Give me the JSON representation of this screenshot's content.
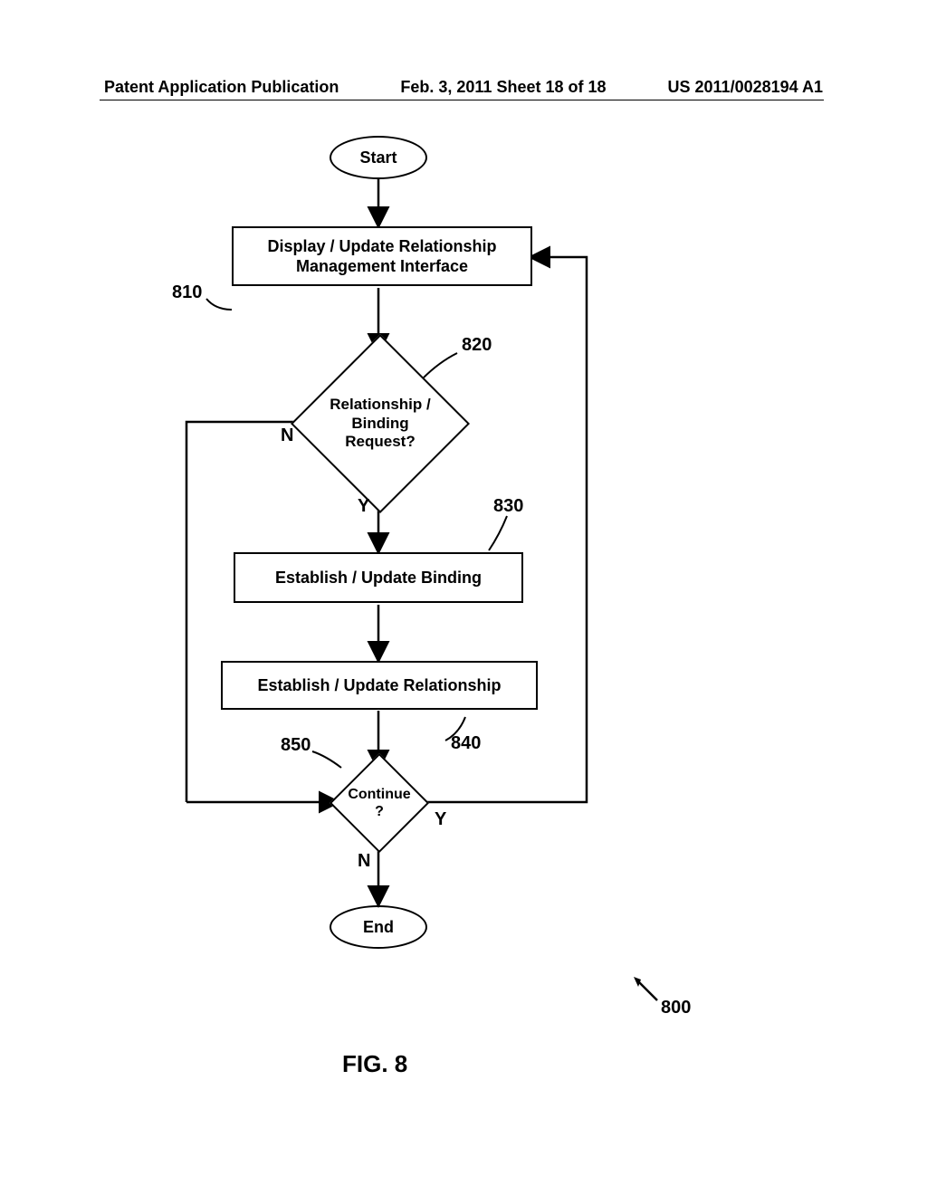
{
  "header": {
    "left": "Patent Application Publication",
    "center": "Feb. 3, 2011   Sheet 18 of 18",
    "right": "US 2011/0028194 A1"
  },
  "flow": {
    "start": "Start",
    "step810": "Display / Update Relationship\nManagement Interface",
    "dec820": "Relationship /\nBinding\nRequest?",
    "step830": "Establish / Update Binding",
    "step840": "Establish / Update Relationship",
    "dec850": "Continue\n?",
    "end": "End",
    "yn": {
      "y": "Y",
      "n": "N"
    }
  },
  "refs": {
    "r810": "810",
    "r820": "820",
    "r830": "830",
    "r840": "840",
    "r850": "850",
    "r800": "800"
  },
  "figure": "FIG. 8"
}
